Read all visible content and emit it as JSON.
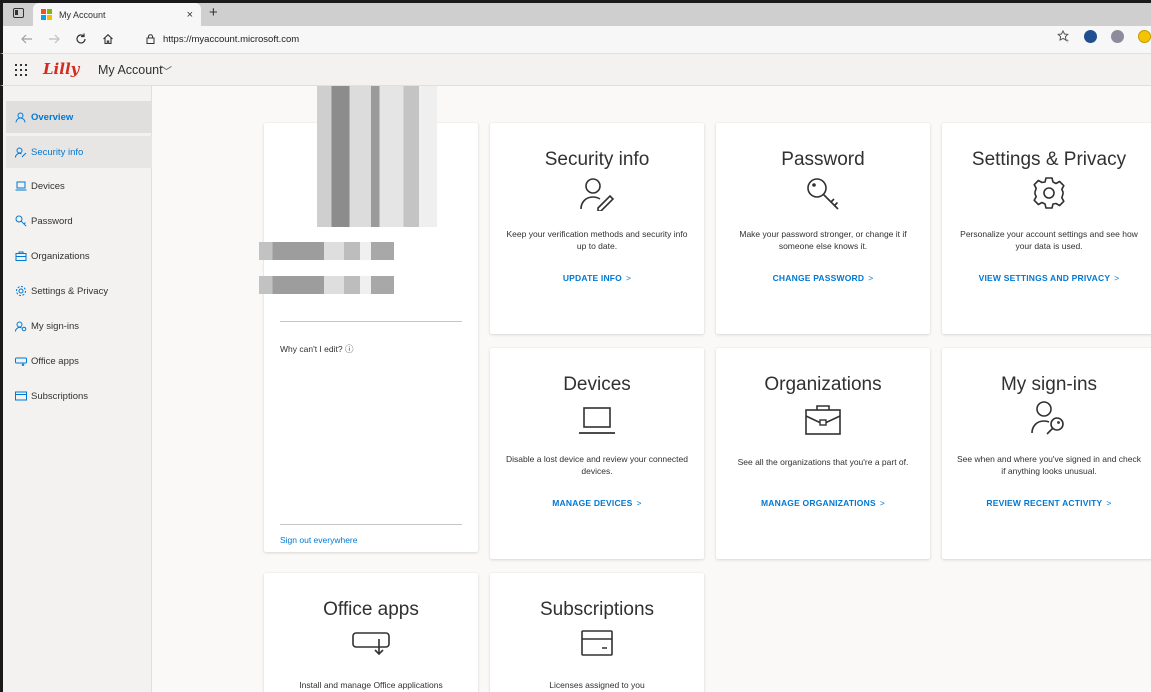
{
  "browser": {
    "tab_title": "My Account",
    "tab_close": "×",
    "new_tab": "+",
    "url": "https://myaccount.microsoft.com",
    "brand_colors": [
      "#f25022",
      "#7fba00",
      "#00a4ef",
      "#ffb900"
    ]
  },
  "header": {
    "brand": "Lilly",
    "app_name": "My Account",
    "chevron": "﹀"
  },
  "sidebar": {
    "items": [
      {
        "label": "Overview",
        "icon": "person-icon"
      },
      {
        "label": "Security info",
        "icon": "person-key-icon"
      },
      {
        "label": "Devices",
        "icon": "laptop-icon"
      },
      {
        "label": "Password",
        "icon": "key-icon"
      },
      {
        "label": "Organizations",
        "icon": "briefcase-icon"
      },
      {
        "label": "Settings & Privacy",
        "icon": "gear-icon"
      },
      {
        "label": "My sign-ins",
        "icon": "person-key-icon"
      },
      {
        "label": "Office apps",
        "icon": "office-apps-icon"
      },
      {
        "label": "Subscriptions",
        "icon": "credit-card-icon"
      }
    ]
  },
  "profile": {
    "cant_edit": "Why can't I edit?",
    "info_glyph": "ⓘ",
    "sign_out": "Sign out everywhere"
  },
  "cards": {
    "security": {
      "title": "Security info",
      "desc": "Keep your verification methods and security info up to date.",
      "link": "UPDATE INFO"
    },
    "password": {
      "title": "Password",
      "desc": "Make your password stronger, or change it if someone else knows it.",
      "link": "CHANGE PASSWORD"
    },
    "settings": {
      "title": "Settings & Privacy",
      "desc": "Personalize your account settings and see how your data is used.",
      "link": "VIEW SETTINGS AND PRIVACY"
    },
    "devices": {
      "title": "Devices",
      "desc": "Disable a lost device and review your connected devices.",
      "link": "MANAGE DEVICES"
    },
    "organizations": {
      "title": "Organizations",
      "desc": "See all the organizations that you're a part of.",
      "link": "MANAGE ORGANIZATIONS"
    },
    "signins": {
      "title": "My sign-ins",
      "desc": "See when and where you've signed in and check if anything looks unusual.",
      "link": "REVIEW RECENT ACTIVITY"
    },
    "office": {
      "title": "Office apps",
      "desc": "Install and manage Office applications"
    },
    "subscriptions": {
      "title": "Subscriptions",
      "desc": "Licenses assigned to you"
    }
  },
  "link_chevron": ">",
  "accent_color": "#0078d4"
}
